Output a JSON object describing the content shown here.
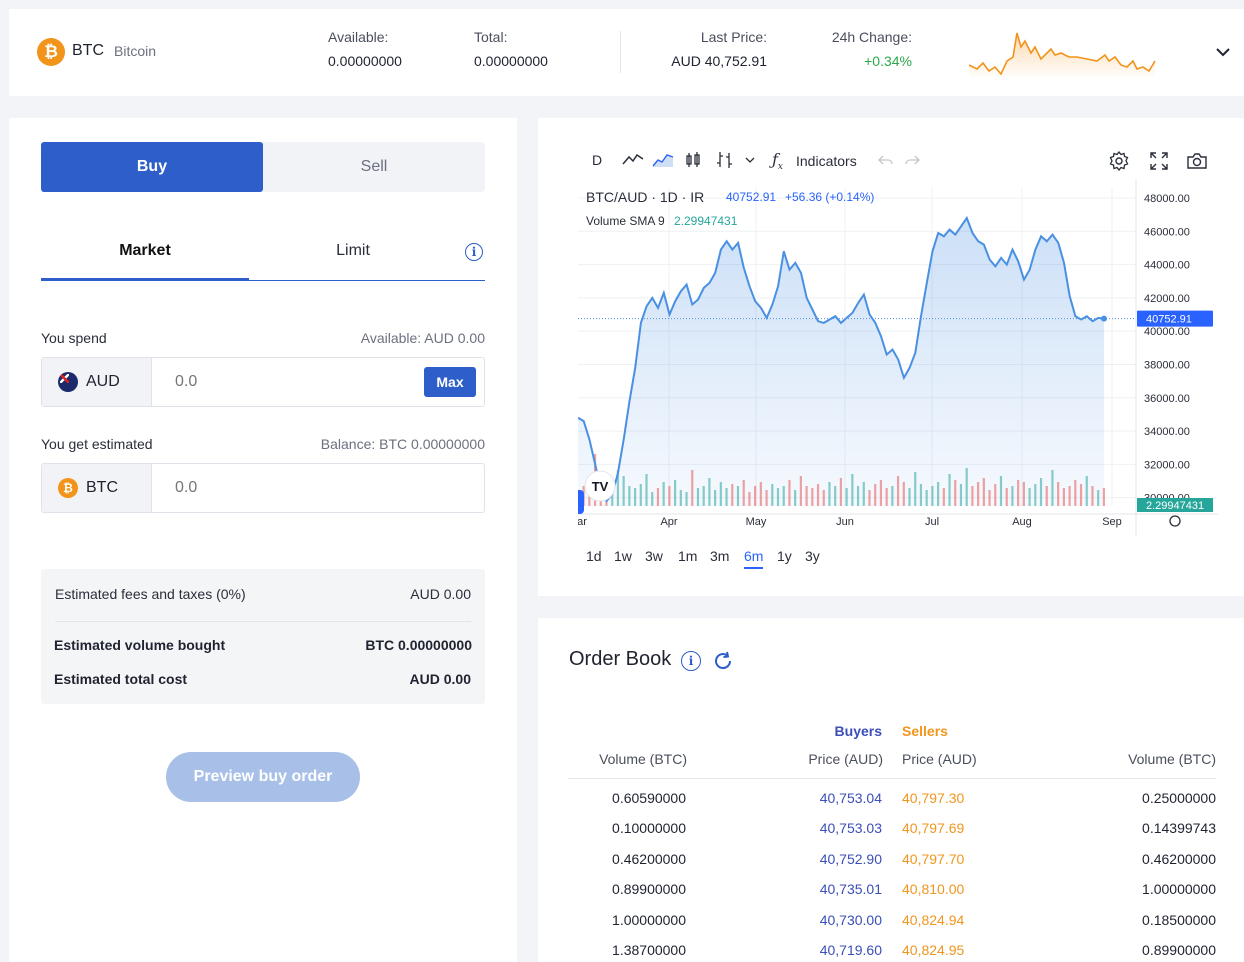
{
  "header": {
    "symbol": "BTC",
    "name": "Bitcoin",
    "available_label": "Available:",
    "available_value": "0.00000000",
    "total_label": "Total:",
    "total_value": "0.00000000",
    "last_price_label": "Last Price:",
    "last_price_value": "AUD 40,752.91",
    "change_label": "24h Change:",
    "change_value": "+0.34%",
    "change_color": "#2aa84a",
    "sparkline_color": "#f2931a"
  },
  "trade": {
    "buy_label": "Buy",
    "sell_label": "Sell",
    "market_label": "Market",
    "limit_label": "Limit",
    "spend_label": "You spend",
    "spend_available": "Available: AUD 0.00",
    "spend_currency": "AUD",
    "spend_placeholder": "0.0",
    "max_label": "Max",
    "get_label": "You get estimated",
    "get_balance": "Balance: BTC 0.00000000",
    "get_currency": "BTC",
    "get_placeholder": "0.0",
    "fees_label": "Estimated fees and taxes (0%)",
    "fees_value": "AUD 0.00",
    "volume_label": "Estimated volume bought",
    "volume_value": "BTC 0.00000000",
    "total_cost_label": "Estimated total cost",
    "total_cost_value": "AUD 0.00",
    "preview_label": "Preview buy order",
    "accent_color": "#2d5ec9"
  },
  "chart": {
    "toolbar": {
      "interval": "D",
      "indicators_label": "Indicators"
    },
    "legend_pair": "BTC/AUD · 1D · IR",
    "legend_price": "40752.91",
    "legend_change": "+56.36 (+0.14%)",
    "legend_volume": "Volume SMA 9",
    "legend_volume_value": "2.29947431",
    "last_price_tag": "40752.91",
    "volume_tag": "2.29947431",
    "ranges": [
      "1d",
      "1w",
      "3w",
      "1m",
      "3m",
      "6m",
      "1y",
      "3y"
    ],
    "active_range": "6m"
  },
  "chart_data": {
    "type": "area",
    "title": "BTC/AUD",
    "ylim": [
      29500,
      48600
    ],
    "y_ticks": [
      "48000.00",
      "46000.00",
      "44000.00",
      "42000.00",
      "40000.00",
      "38000.00",
      "36000.00",
      "34000.00",
      "32000.00",
      "30000.00"
    ],
    "x_ticks": [
      "ar",
      "Apr",
      "May",
      "Jun",
      "Jul",
      "Aug",
      "Sep"
    ],
    "series": [
      {
        "values": [
          34800,
          34600,
          33500,
          32000,
          30500,
          29800,
          30200,
          31500,
          33500,
          35800,
          37800,
          40500,
          41500,
          42000,
          41400,
          42300,
          41000,
          41800,
          42400,
          42800,
          41600,
          41900,
          42600,
          42900,
          43500,
          44900,
          45400,
          44900,
          45300,
          43800,
          42700,
          41800,
          41400,
          40800,
          41600,
          42700,
          44800,
          43700,
          44100,
          43500,
          42000,
          41300,
          40600,
          40500,
          40700,
          40900,
          40500,
          40800,
          41100,
          41700,
          42200,
          41000,
          40500,
          39700,
          38600,
          38900,
          38300,
          37200,
          37800,
          38700,
          40900,
          42900,
          44800,
          45900,
          45700,
          46100,
          45800,
          46300,
          46800,
          45900,
          45400,
          45200,
          44300,
          43900,
          44400,
          44000,
          44900,
          44200,
          43100,
          43700,
          44900,
          45700,
          45400,
          45800,
          45300,
          44100,
          42100,
          40900,
          40700,
          40900,
          40600,
          40800,
          40752.91
        ]
      }
    ],
    "volume": [
      0.8,
      1.0,
      1.1,
      2.6,
      0.9,
      1.0,
      1.2,
      1.8,
      1.5,
      1.0,
      0.9,
      1.1,
      1.6,
      0.7,
      0.9,
      1.2,
      1.0,
      1.3,
      0.8,
      0.7,
      1.8,
      0.9,
      1.0,
      1.4,
      0.8,
      1.2,
      0.9,
      1.1,
      1.0,
      1.3,
      0.7,
      1.0,
      1.2,
      0.8,
      1.1,
      0.9,
      1.0,
      1.3,
      0.8,
      1.5,
      1.0,
      0.9,
      1.1,
      0.8,
      1.2,
      1.0,
      1.4,
      0.9,
      1.6,
      1.0,
      1.2,
      0.8,
      1.1,
      1.3,
      0.9,
      1.0,
      1.5,
      1.2,
      0.9,
      1.7,
      1.1,
      0.8,
      1.0,
      1.2,
      0.9,
      1.6,
      1.3,
      1.1,
      1.9,
      1.0,
      1.2,
      1.4,
      0.8,
      1.1,
      1.5,
      0.9,
      1.0,
      1.3,
      1.2,
      0.9,
      1.1,
      1.4,
      1.0,
      1.8,
      1.2,
      0.9,
      1.0,
      1.3,
      1.1,
      1.5,
      1.0,
      0.8,
      0.9
    ],
    "colors": {
      "line": "#4a90e2",
      "up": "#26a69a",
      "down": "#ef5350"
    },
    "grid": true
  },
  "orderbook": {
    "title": "Order Book",
    "buyers_label": "Buyers",
    "sellers_label": "Sellers",
    "col_buy_volume": "Volume (BTC)",
    "col_buy_price": "Price (AUD)",
    "col_sell_price": "Price (AUD)",
    "col_sell_volume": "Volume (BTC)",
    "buyers_color": "#3b4fb8",
    "sellers_color": "#f0961e",
    "rows": [
      {
        "buy_volume": "0.60590000",
        "buy_price": "40,753.04",
        "sell_price": "40,797.30",
        "sell_volume": "0.25000000"
      },
      {
        "buy_volume": "0.10000000",
        "buy_price": "40,753.03",
        "sell_price": "40,797.69",
        "sell_volume": "0.14399743"
      },
      {
        "buy_volume": "0.46200000",
        "buy_price": "40,752.90",
        "sell_price": "40,797.70",
        "sell_volume": "0.46200000"
      },
      {
        "buy_volume": "0.89900000",
        "buy_price": "40,735.01",
        "sell_price": "40,810.00",
        "sell_volume": "1.00000000"
      },
      {
        "buy_volume": "1.00000000",
        "buy_price": "40,730.00",
        "sell_price": "40,824.94",
        "sell_volume": "0.18500000"
      },
      {
        "buy_volume": "1.38700000",
        "buy_price": "40,719.60",
        "sell_price": "40,824.95",
        "sell_volume": "0.89900000"
      }
    ]
  }
}
